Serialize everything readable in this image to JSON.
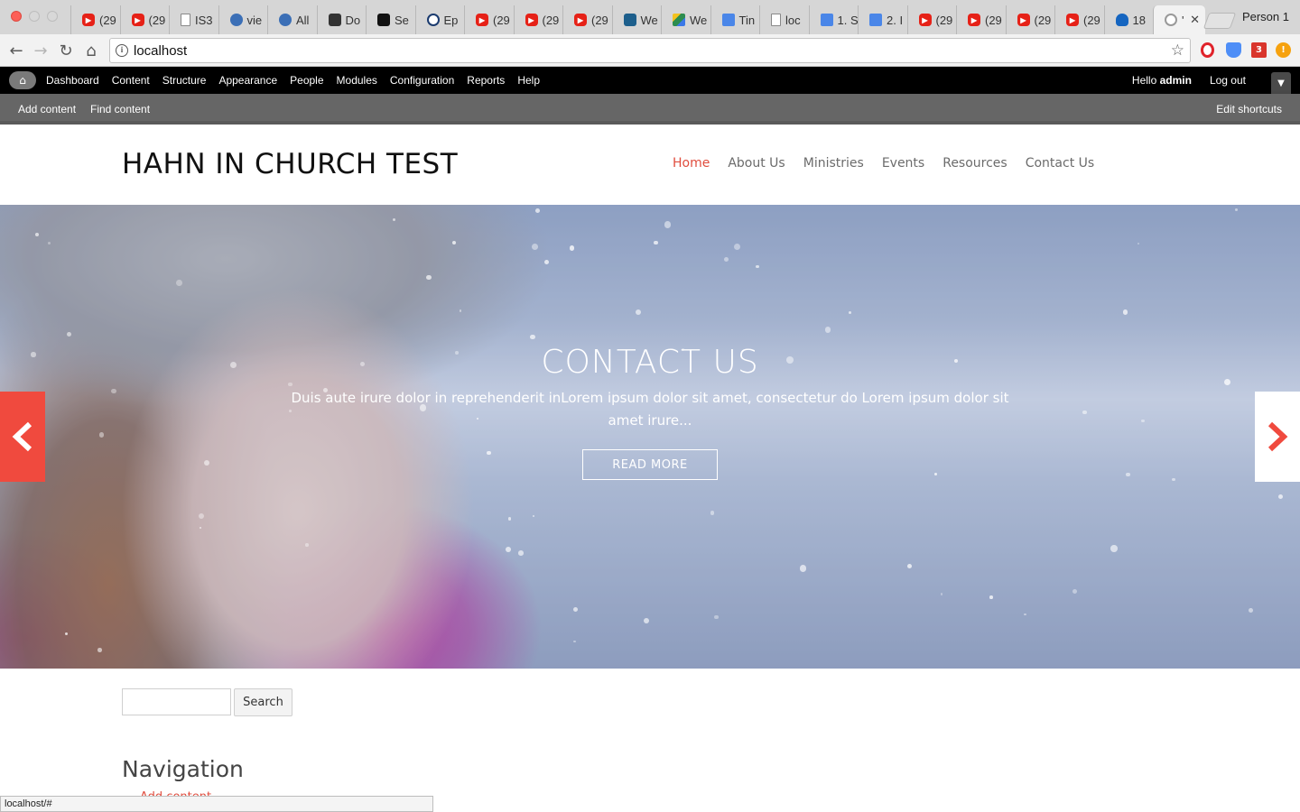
{
  "browser": {
    "tabs": [
      {
        "icon": "youtube-icon",
        "label": "(29"
      },
      {
        "icon": "youtube-icon",
        "label": "(29"
      },
      {
        "icon": "document-icon",
        "label": "IS3"
      },
      {
        "icon": "drupal-icon",
        "label": "vie"
      },
      {
        "icon": "drupal-icon",
        "label": "All"
      },
      {
        "icon": "dark-app-icon",
        "label": "Do"
      },
      {
        "icon": "black-app-icon",
        "label": "Se"
      },
      {
        "icon": "edge-icon",
        "label": "Ep"
      },
      {
        "icon": "youtube-icon",
        "label": "(29"
      },
      {
        "icon": "youtube-icon",
        "label": "(29"
      },
      {
        "icon": "youtube-icon",
        "label": "(29"
      },
      {
        "icon": "trello-icon",
        "label": "We"
      },
      {
        "icon": "google-drive-icon",
        "label": "We"
      },
      {
        "icon": "google-docs-icon",
        "label": "Tin"
      },
      {
        "icon": "document-icon",
        "label": "loc"
      },
      {
        "icon": "google-docs-icon",
        "label": "1. S"
      },
      {
        "icon": "google-docs-icon",
        "label": "2. I"
      },
      {
        "icon": "youtube-icon",
        "label": "(29"
      },
      {
        "icon": "youtube-icon",
        "label": "(29"
      },
      {
        "icon": "youtube-icon",
        "label": "(29"
      },
      {
        "icon": "youtube-icon",
        "label": "(29"
      },
      {
        "icon": "onedrive-icon",
        "label": "18"
      },
      {
        "icon": "loading-icon",
        "label": "'",
        "active": true
      }
    ],
    "profile": "Person 1",
    "url": "localhost",
    "status_url": "localhost/#",
    "extension_badge": "3"
  },
  "admin_toolbar": {
    "menu": [
      "Dashboard",
      "Content",
      "Structure",
      "Appearance",
      "People",
      "Modules",
      "Configuration",
      "Reports",
      "Help"
    ],
    "hello_prefix": "Hello",
    "username": "admin",
    "logout": "Log out",
    "shortcuts": {
      "add_content": "Add content",
      "find_content": "Find content",
      "edit_shortcuts": "Edit shortcuts"
    }
  },
  "site": {
    "name": "HAHN IN CHURCH TEST",
    "nav": [
      "Home",
      "About Us",
      "Ministries",
      "Events",
      "Resources",
      "Contact Us"
    ],
    "active_nav": "Home",
    "accent_color": "#e04c3d"
  },
  "hero": {
    "title": "CONTACT US",
    "body": "Duis aute irure dolor in reprehenderit inLorem ipsum dolor sit amet, consectetur do Lorem ipsum dolor sit amet irure...",
    "button": "READ MORE"
  },
  "search": {
    "button": "Search",
    "value": ""
  },
  "navigation_block": {
    "title": "Navigation",
    "first_link": "Add content"
  }
}
